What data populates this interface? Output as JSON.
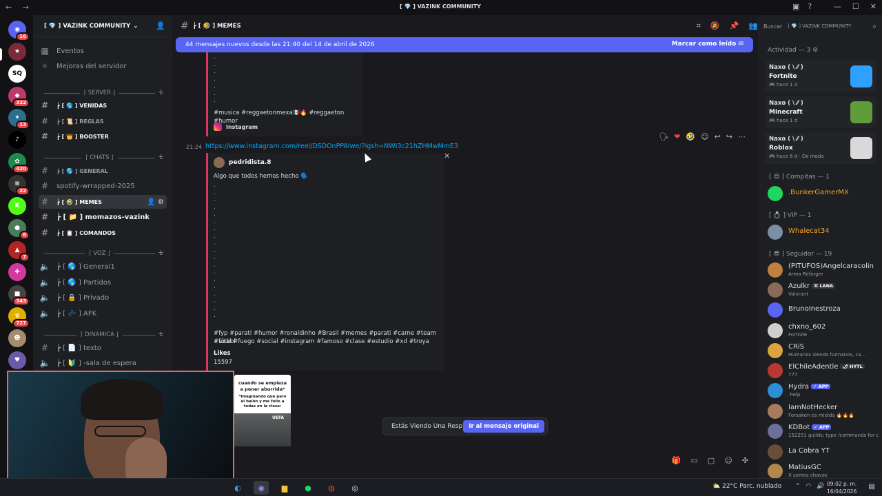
{
  "window": {
    "title": "[ 💎 ]  VAZINK COMMUNITY",
    "nav_arrows": "← →"
  },
  "rail": {
    "servers": [
      {
        "name": "Discord home",
        "badge": "16",
        "color": "#5865f2",
        "glyph": "◉"
      },
      {
        "name": "Server 2",
        "badge": "",
        "color": "#7a2a3a",
        "glyph": "★"
      },
      {
        "name": "Squad House",
        "badge": "",
        "color": "#ffffff",
        "glyph": "SQ"
      },
      {
        "name": "Server 4",
        "badge": "322",
        "color": "#c0396b",
        "glyph": "◆"
      },
      {
        "name": "Server 5",
        "badge": "13",
        "color": "#2b6f8f",
        "glyph": "✦"
      },
      {
        "name": "TikTok",
        "badge": "",
        "color": "#000000",
        "glyph": "♪"
      },
      {
        "name": "Server 7",
        "badge": "420",
        "color": "#1e8a4c",
        "glyph": "✿"
      },
      {
        "name": "Server 8",
        "badge": "22",
        "color": "#333333",
        "glyph": "≡"
      },
      {
        "name": "Kick",
        "badge": "",
        "color": "#53fc18",
        "glyph": "K"
      },
      {
        "name": "Server 10",
        "badge": "6",
        "color": "#4a7c59",
        "glyph": "●"
      },
      {
        "name": "Server 11",
        "badge": "7",
        "color": "#b32424",
        "glyph": "▲"
      },
      {
        "name": "Server 12",
        "badge": "",
        "color": "#d23aa0",
        "glyph": "✚"
      },
      {
        "name": "Server 13",
        "badge": "343",
        "color": "#444444",
        "glyph": "■"
      },
      {
        "name": "Server 14",
        "badge": "727",
        "color": "#e0b000",
        "glyph": "♛"
      },
      {
        "name": "Server 15",
        "badge": "",
        "color": "#a58c6d",
        "glyph": "☻"
      },
      {
        "name": "Server 16",
        "badge": "",
        "color": "#6b5aa8",
        "glyph": "♥"
      }
    ]
  },
  "sidebar": {
    "guild_name": "[ 💎 ]  VAZINK COMMUNITY",
    "events": "Eventos",
    "boosts": "Mejoras del servidor",
    "categories": {
      "server": "⌈ SERVER ⌋",
      "chats": "⌈ CHATS ⌋",
      "voz": "⌈ VOZ ⌋",
      "dinamica": "⌈ DINAMICA ⌋"
    },
    "channels": {
      "vinculos": "┢ [ 🌎 ]  VENIDAS",
      "reglas": "┢ [ 📜 ]  REGLAS",
      "booster": "┢ [ 👑 ]  BOOSTER",
      "general": "┢ [ 🌎 ]  GENERAL",
      "spotify": "spotify-wrrapped-2025",
      "memes": "┢ [ 🤣 ]  MEMES",
      "momazos": "┢ [ 📁 ]  momazos-vazink",
      "comandos": "┢ [ 📋 ]  COMANDOS",
      "general1": "┢ [ 🌎 ]  General1",
      "partidos": "┢ [ 🌎 ]  Partidos",
      "privado": "┢ [ 🔒 ]  Privado",
      "afk": "┢ [ 💤 ]  AFK",
      "texto": "┢ [ 📄 ]  texto",
      "espera": "┢ [ 🔰 ]  -sala de espera"
    }
  },
  "main": {
    "channel_title": "┢ [ 🤣 ]  MEMES",
    "new_messages": "44 mensajes nuevos desde las 21:40 del 14 de abril de 2026",
    "mark_read": "Marcar como leído",
    "embed1": {
      "hashtags": "#musica #reggaetonmexa🇲🇽🔥 #reggaeton #humor",
      "source": "Instagram"
    },
    "message": {
      "time": "21:24",
      "link": "https://www.instagram.com/reel/DSDOnPPAIwe/?igsh=NWI3c21hZHMwMmE3"
    },
    "embed2": {
      "author": "pedridista.8",
      "description": "Algo que todos hemos hecho 🗣️",
      "hashtags_1": "#fyp #parati #humor #ronaldinho #Brasil #memes #parati #carne #team #fútbol",
      "hashtags_2": "#viral #fuego #social #instagram #famoso #clase #estudio #xd #troya",
      "likes_label": "Likes",
      "likes_value": "15597"
    },
    "thumb": {
      "caption_1": "cuando se empieza a poner aburrida*",
      "caption_2": "*imaginando que paro el balón y me follo a todas en la clase:",
      "logo": "UEFA"
    },
    "reply": {
      "text": "Estás Viendo Una Respuesta.",
      "jump": "Ir al mensaje original"
    }
  },
  "members": {
    "search_placeholder": "Buscar",
    "search_scope": "[ 💎 ]  VAZINK COMMUNITY",
    "activity_title": "Actividad — 3",
    "activities": [
      {
        "user": "Naxo ( \\ ⁄⁄ )",
        "game": "Fortnite",
        "when": "hace 1 d",
        "color": "#2ea0ff"
      },
      {
        "user": "Naxo ( \\ ⁄⁄ )",
        "game": "Minecraft",
        "when": "hace 1 d",
        "color": "#5f9d3a"
      },
      {
        "user": "Naxo ( \\ ⁄⁄ )",
        "game": "Roblox",
        "when": "hace 6 d · De moda",
        "color": "#d9d9d9"
      }
    ],
    "groups": {
      "compitas": "[ 😍 ]  Compitas — 1",
      "vip": "[ 💍 ]  VIP — 1",
      "seguidor": "[ 😎 ]  Seguidor — 19"
    },
    "list": [
      {
        "name": ".BunkerGamerMX",
        "status": "",
        "color": "#1ed760",
        "name_color": "#f5a623"
      },
      {
        "name": "Whalecat34",
        "status": "",
        "color": "#7b8fa3",
        "name_color": "#f5a623"
      },
      {
        "name": "(PITUFOS)Angelcaracolin",
        "status": "Arma Reforger",
        "color": "#c08040",
        "name_color": "#dbdee1"
      },
      {
        "name": "Azulkr",
        "tag": "⌘ LANA",
        "status": "Valorant",
        "color": "#8c6a5a",
        "name_color": "#dbdee1"
      },
      {
        "name": "BrunoInestroza",
        "status": "",
        "color": "#5865f2",
        "name_color": "#dbdee1"
      },
      {
        "name": "chxno_602",
        "status": "Fortnite",
        "color": "#cfcfcf",
        "name_color": "#dbdee1"
      },
      {
        "name": "CRiS",
        "status": "Humanos siendo humanos, ca...",
        "color": "#d9a441",
        "name_color": "#dbdee1"
      },
      {
        "name": "ElChileAdentle",
        "tag": "🌶 HYTL",
        "status": "777",
        "color": "#b8392f",
        "name_color": "#dbdee1"
      },
      {
        "name": "Hydra",
        "tag": "✓ APP",
        "status": ".help",
        "color": "#2b8fd6",
        "name_color": "#dbdee1"
      },
      {
        "name": "IamNotHecker",
        "status": "Forsaken es mielda 🔥🔥🔥",
        "color": "#a67a5a",
        "name_color": "#dbdee1"
      },
      {
        "name": "KDBot",
        "tag": "✓ APP",
        "status": "152251 guilds; type /commands for c",
        "color": "#6b6f9a",
        "name_color": "#dbdee1"
      },
      {
        "name": "La Cobra YT",
        "status": "",
        "color": "#6a4e3a",
        "name_color": "#dbdee1"
      },
      {
        "name": "MatiusGC",
        "status": "X somos chavos",
        "color": "#b0874d",
        "name_color": "#dbdee1"
      }
    ]
  },
  "taskbar": {
    "weather": "22°C  Parc. nublado",
    "time": "09:02 p. m.",
    "date": "16/04/2026"
  },
  "colors": {
    "accent": "#5865f2",
    "embed_bar": "#d8365f",
    "link": "#00a8fc"
  }
}
